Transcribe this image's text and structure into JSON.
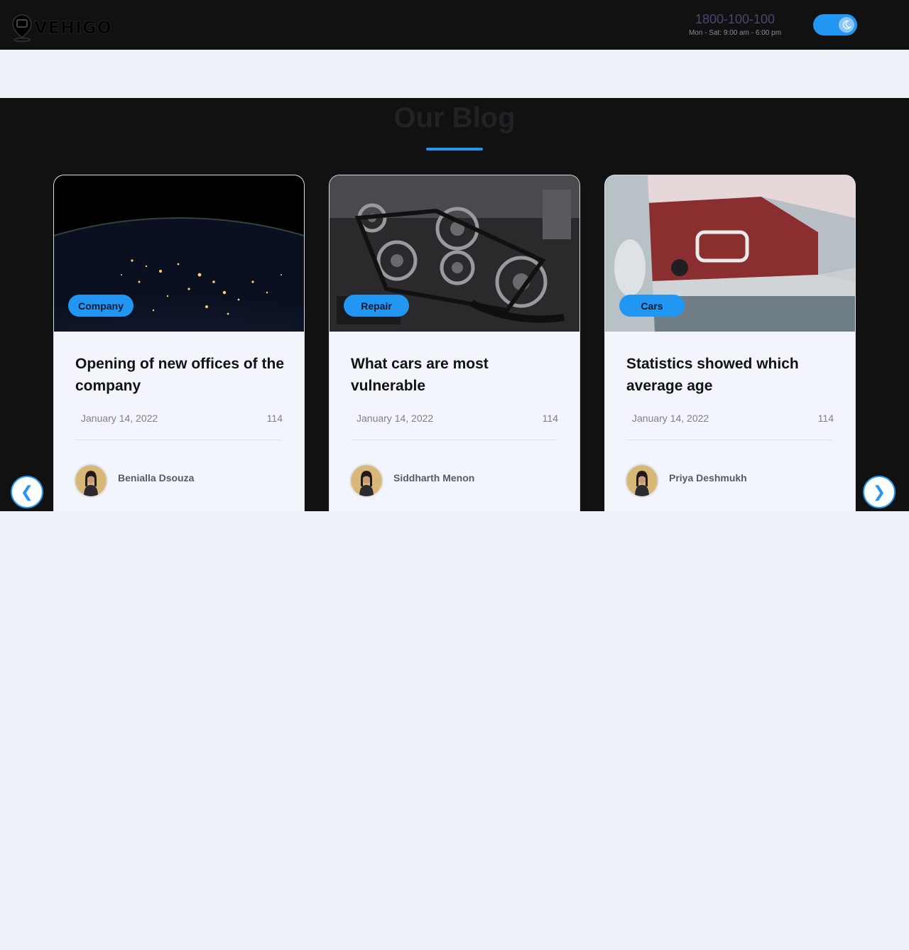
{
  "header": {
    "logo_text": "VEHIGO",
    "phone": "1800-100-100",
    "hours": "Mon - Sat: 9:00 am - 6:00 pm",
    "theme_toggle": "dark-mode-toggle"
  },
  "blog": {
    "title": "Our Blog",
    "accent_color": "#2196f3",
    "posts": [
      {
        "category": "Company",
        "title": "Opening of new offices of the company",
        "date": "January 14, 2022",
        "views": "114",
        "author": "Benialla Dsouza",
        "image": "earth-at-night"
      },
      {
        "category": "Repair",
        "title": "What cars are most vulnerable",
        "date": "January 14, 2022",
        "views": "114",
        "author": "Siddharth Menon",
        "image": "car-engine"
      },
      {
        "category": "Cars",
        "title": "Statistics showed which average age",
        "date": "January 14, 2022",
        "views": "114",
        "author": "Priya Deshmukh",
        "image": "parked-classic-cars"
      }
    ],
    "prev_icon": "chevron-left-icon",
    "next_icon": "chevron-right-icon",
    "prev_glyph": "❮",
    "next_glyph": "❯"
  }
}
